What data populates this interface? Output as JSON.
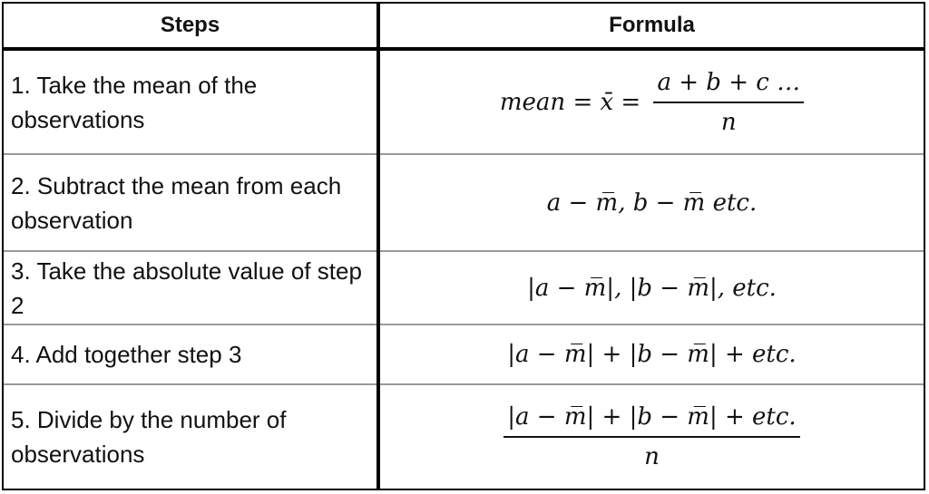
{
  "table": {
    "headers": {
      "steps": "Steps",
      "formula": "Formula"
    },
    "rows": [
      {
        "step": "1. Take the mean of the observations",
        "formula": {
          "lhs": "mean = x̄ =",
          "numerator": "a + b + c …",
          "denominator": "n"
        }
      },
      {
        "step": "2. Subtract the mean from each observation",
        "formula": {
          "text": "a − m̅, b − m̅ etc."
        }
      },
      {
        "step": "3. Take the absolute value of step 2",
        "formula": {
          "text": "|a − m̅|, |b − m̅|, etc."
        }
      },
      {
        "step": "4. Add together step 3",
        "formula": {
          "text": "|a − m̅| +  |b − m̅| +  etc."
        }
      },
      {
        "step": "5. Divide by the number of observations",
        "formula": {
          "numerator": "|a − m̅| +  |b − m̅| + etc.",
          "denominator": "n"
        }
      }
    ]
  }
}
